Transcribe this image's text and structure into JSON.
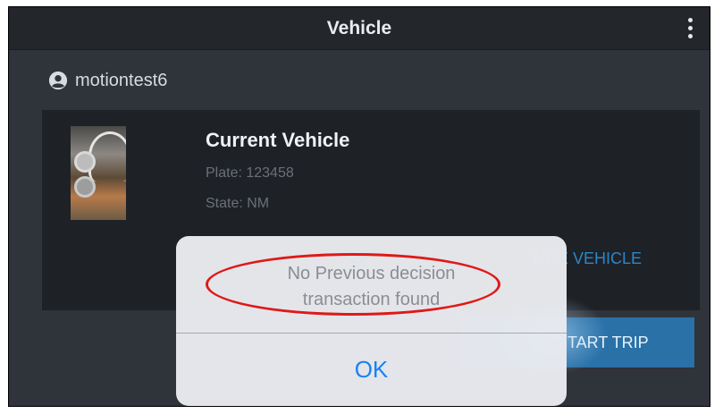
{
  "header": {
    "title": "Vehicle",
    "menu_icon": "more-vertical-icon"
  },
  "user": {
    "icon": "account-circle-icon",
    "name": "motiontest6"
  },
  "vehicle": {
    "title": "Current Vehicle",
    "plate": "Plate: 123458",
    "state": "State: NM",
    "change_label": "NGE VEHICLE"
  },
  "actions": {
    "start_trip_label": "TART TRIP"
  },
  "alert": {
    "message": "No Previous decision transaction found",
    "ok_label": "OK"
  },
  "colors": {
    "background": "#2f333a",
    "topbar": "#23262b",
    "card": "#1e2126",
    "accent": "#2d86c6",
    "button": "#2a71a8",
    "alert_button": "#1a82f4",
    "annotation": "#e01818"
  }
}
